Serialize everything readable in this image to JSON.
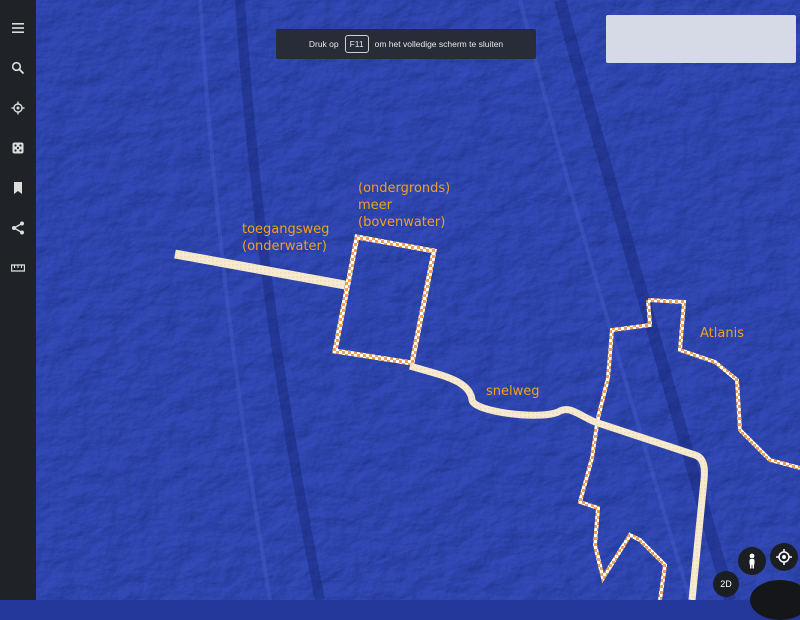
{
  "sidebar": {
    "items": [
      {
        "icon": "menu-icon"
      },
      {
        "icon": "search-icon"
      },
      {
        "icon": "voyager-icon"
      },
      {
        "icon": "feeling-lucky-icon"
      },
      {
        "icon": "bookmark-icon"
      },
      {
        "icon": "share-icon"
      },
      {
        "icon": "measure-icon"
      }
    ]
  },
  "fullscreen_notice": {
    "prefix": "Druk op",
    "key": "F11",
    "suffix": "om het volledige scherm te sluiten"
  },
  "map": {
    "labels": {
      "access_road": "toegangsweg\n(onderwater)",
      "lake": "(ondergronds)\nmeer\n(bovenwater)",
      "highway": "snelweg",
      "atlantis": "Atlanis"
    },
    "colors": {
      "ocean": "#23389a",
      "label": "#f2a01e",
      "outline": "#e8862a",
      "road": "#f4e6c6"
    }
  },
  "controls": {
    "view_mode": "2D"
  }
}
